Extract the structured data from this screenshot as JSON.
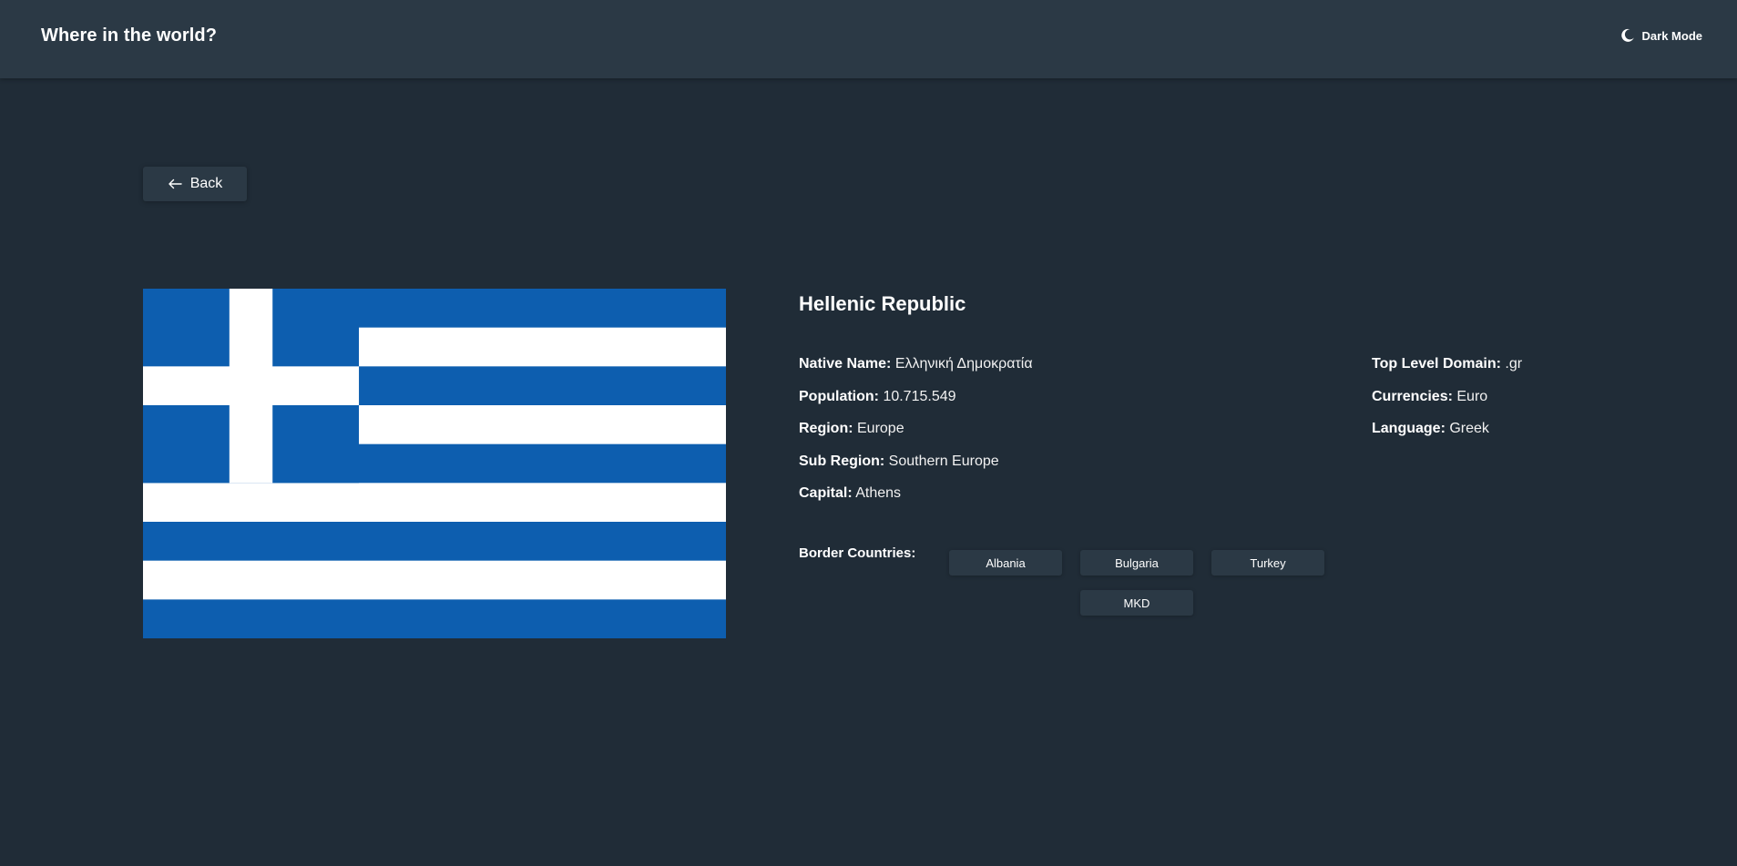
{
  "header": {
    "title": "Where in the world?",
    "theme_toggle_label": "Dark Mode",
    "theme_icon": "moon-icon"
  },
  "back": {
    "label": "Back",
    "icon": "arrow-left-icon"
  },
  "country": {
    "name": "Hellenic Republic",
    "flag_icon": "greek-flag",
    "left_details": [
      {
        "label": "Native Name:",
        "value": "Ελληνική Δημοκρατία"
      },
      {
        "label": "Population:",
        "value": "10.715.549"
      },
      {
        "label": "Region:",
        "value": "Europe"
      },
      {
        "label": "Sub Region:",
        "value": "Southern Europe"
      },
      {
        "label": "Capital:",
        "value": "Athens"
      }
    ],
    "right_details": [
      {
        "label": "Top Level Domain:",
        "value": ".gr"
      },
      {
        "label": "Currencies:",
        "value": "Euro"
      },
      {
        "label": "Language:",
        "value": "Greek"
      }
    ],
    "borders_label": "Border Countries:",
    "border_countries": [
      "Albania",
      "Bulgaria",
      "Turkey",
      "MKD"
    ]
  },
  "colors": {
    "background": "#202c37",
    "elements": "#2b3945",
    "text": "#ffffff",
    "flag_blue": "#0d5eaf",
    "flag_white": "#ffffff"
  }
}
